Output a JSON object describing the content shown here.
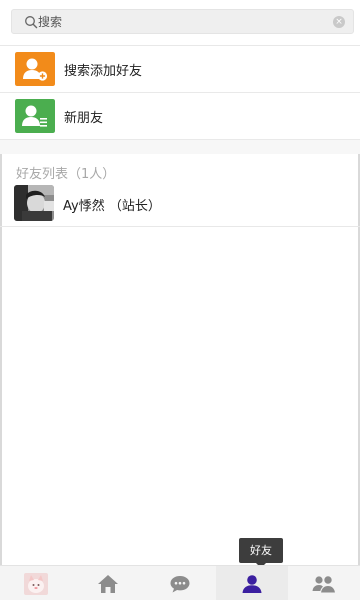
{
  "search": {
    "placeholder": "搜索",
    "clear_glyph": "×"
  },
  "actions": [
    {
      "label": "搜索添加好友",
      "icon": "add-user-icon",
      "color": "#f28b1a"
    },
    {
      "label": "新朋友",
      "icon": "contact-list-icon",
      "color": "#4bae4f"
    }
  ],
  "friends_section": {
    "title": "好友列表（1人）"
  },
  "friends": [
    {
      "name": "Ay悸然 （站长）"
    }
  ],
  "tooltip": {
    "label": "好友"
  },
  "tabbar": {
    "items": [
      {
        "icon": "profile-avatar-icon"
      },
      {
        "icon": "home-icon"
      },
      {
        "icon": "chat-icon"
      },
      {
        "icon": "friends-icon",
        "active": true
      },
      {
        "icon": "groups-icon"
      }
    ],
    "active_color": "#3b1fa0",
    "inactive_color": "#8c8c8c"
  }
}
